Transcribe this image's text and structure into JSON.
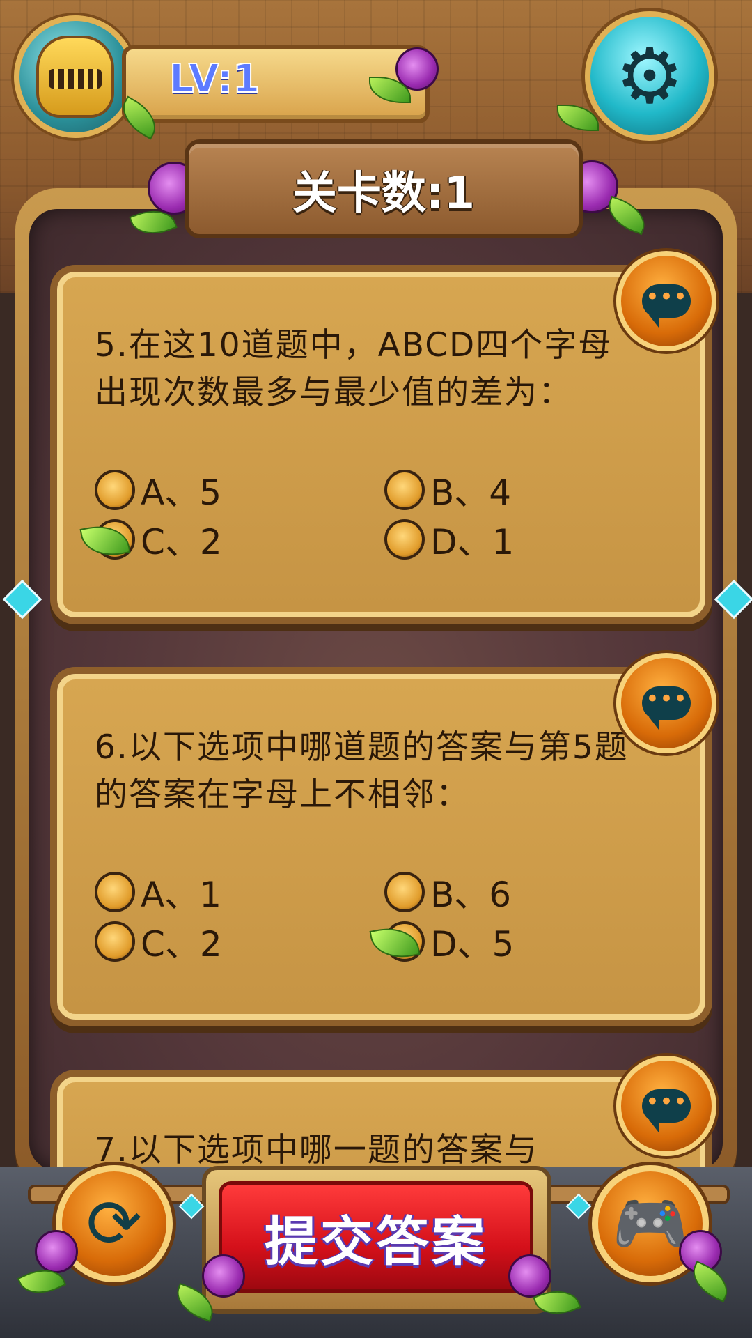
{
  "header": {
    "level_label": "LV:1",
    "stage_title": "关卡数:1"
  },
  "questions": [
    {
      "text": "5.在这10道题中，ABCD四个字母出现次数最多与最少值的差为：",
      "options": [
        {
          "label": "A、5",
          "selected": false
        },
        {
          "label": "B、4",
          "selected": false
        },
        {
          "label": "C、2",
          "selected": true
        },
        {
          "label": "D、1",
          "selected": false
        }
      ]
    },
    {
      "text": "6.以下选项中哪道题的答案与第5题的答案在字母上不相邻：",
      "options": [
        {
          "label": "A、1",
          "selected": false
        },
        {
          "label": "B、6",
          "selected": false
        },
        {
          "label": "C、2",
          "selected": false
        },
        {
          "label": "D、5",
          "selected": true
        }
      ]
    },
    {
      "text": "7.以下选项中哪一题的答案与"
    }
  ],
  "footer": {
    "submit_label": "提交答案"
  },
  "icons": {
    "avatar": "knight-helmet-icon",
    "settings": "gear-icon",
    "hint": "chat-bubble-icon",
    "refresh": "refresh-icon",
    "games": "gamepad-icon"
  },
  "colors": {
    "submit": "#d4101a",
    "accent_button": "#d86b08",
    "settings_button": "#21b9c9"
  }
}
